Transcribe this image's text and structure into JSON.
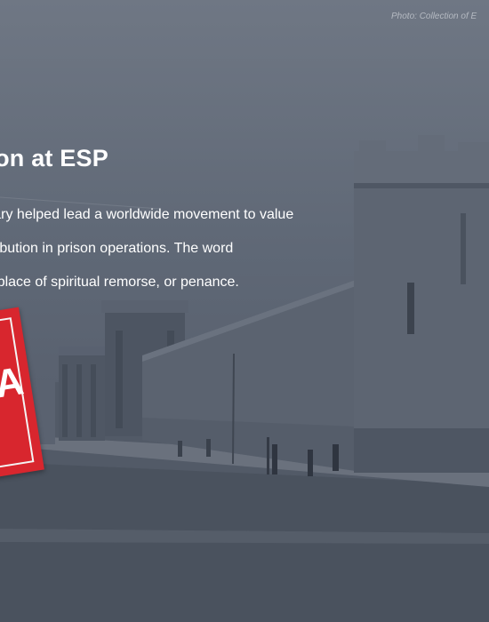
{
  "photo_credit": "Photo: Collection of E",
  "headline": "ation at ESP",
  "body_lines": [
    "tentiary helped lead a worldwide movement to value",
    "r retribution in prison operations. The word",
    "ns a place of spiritual remorse, or penance."
  ],
  "badge_letter": "A",
  "colors": {
    "sky": "#6f7784",
    "wall": "#4c5461",
    "street": "#4a525e",
    "badge": "#d8262e",
    "text": "#ffffff"
  }
}
